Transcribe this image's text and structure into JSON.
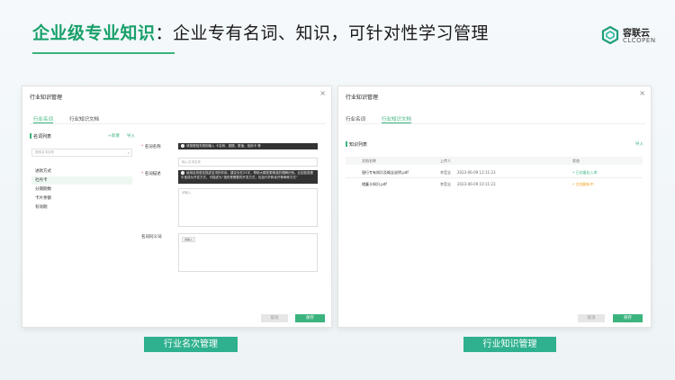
{
  "slide": {
    "title_highlight": "企业级专业知识",
    "title_rest": "：企业专有名词、知识，可针对性学习管理",
    "logo_cn": "容联云",
    "logo_en": "CLCOPEN"
  },
  "left_panel": {
    "title": "行业知识管理",
    "close": "×",
    "tabs": [
      {
        "label": "行业名词",
        "active": true
      },
      {
        "label": "行业知识文档",
        "active": false
      }
    ],
    "list_title": "名词列表",
    "add_link": "+新增",
    "import_link": "导入",
    "search_placeholder": "搜索名词名称",
    "items": [
      "进款方式",
      "社丹卡",
      "分期期数",
      "卡片余额",
      "有效期"
    ],
    "selected_index": 1,
    "form": {
      "name_label": "名词名称",
      "name_tip": "请按照相关规则输入 卡名称、银额、数值、信用卡 等",
      "name_placeholder": "输入名词名称",
      "desc_label": "名词描述",
      "desc_tip": "使用自然语言描述名词的作用，建议长在25字，帮助大模型更精准的理解识别。比如信息看中宝成为开发方式，可描述为“指的是需要的开发方式，包括代开和卖开等两种方式”",
      "desc_placeholder": "请输入",
      "syn_label": "名词同义词",
      "syn_chip": "请输入"
    },
    "cancel_label": "取消",
    "save_label": "保存"
  },
  "right_panel": {
    "title": "行业知识管理",
    "close": "×",
    "tabs": [
      {
        "label": "行业名词",
        "active": false
      },
      {
        "label": "行业知识文档",
        "active": true
      }
    ],
    "list_title": "知识列表",
    "import_link": "导入",
    "columns": [
      "文档名称",
      "上传人",
      "",
      "状态"
    ],
    "rows": [
      {
        "name": "银行专有知识及概念说明.pdf",
        "uploader": "李莹念",
        "time": "2023-06-09 12:11:23",
        "status": "• 已向量化入库",
        "status_type": "ok"
      },
      {
        "name": "储蓄卡知识.pdf",
        "uploader": "李莹念",
        "time": "2023-06-09 10:11:23",
        "status": "• 文档解析中",
        "status_type": "warn"
      }
    ],
    "cancel_label": "取消",
    "save_label": "保存"
  },
  "captions": {
    "left": "行业名次管理",
    "right": "行业知识管理"
  }
}
